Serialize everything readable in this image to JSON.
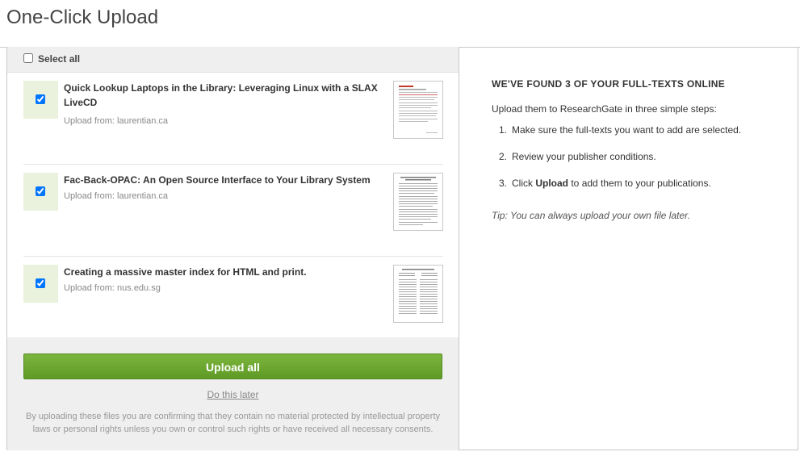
{
  "page": {
    "title": "One-Click Upload"
  },
  "select_all": {
    "label": "Select all",
    "checked": false
  },
  "publications": [
    {
      "title": "Quick Lookup Laptops in the Library: Leveraging Linux with a SLAX LiveCD",
      "source": "Upload from: laurentian.ca",
      "checked": true
    },
    {
      "title": "Fac-Back-OPAC: An Open Source Interface to Your Library System",
      "source": "Upload from: laurentian.ca",
      "checked": true
    },
    {
      "title": "Creating a massive master index for HTML and print.",
      "source": "Upload from: nus.edu.sg",
      "checked": true
    }
  ],
  "actions": {
    "upload_all": "Upload all",
    "do_later": "Do this later"
  },
  "disclaimer": "By uploading these files you are confirming that they contain no material protected by intellectual property laws or personal rights unless you own or control such rights or have received all necessary consents.",
  "info": {
    "heading": "WE'VE FOUND 3 OF YOUR FULL-TEXTS ONLINE",
    "intro": "Upload them to ResearchGate in three simple steps:",
    "steps": [
      {
        "num": "1.",
        "text": "Make sure the full-texts you want to add are selected."
      },
      {
        "num": "2.",
        "text": "Review your publisher conditions."
      },
      {
        "num": "3.",
        "pre": "Click ",
        "bold": "Upload",
        "post": " to add them to your publications."
      }
    ],
    "tip": "Tip: You can always upload your own file later."
  },
  "colors": {
    "accent": "#6aa82f",
    "check_bg": "#eaf2dd",
    "panel_bg": "#efefef"
  }
}
